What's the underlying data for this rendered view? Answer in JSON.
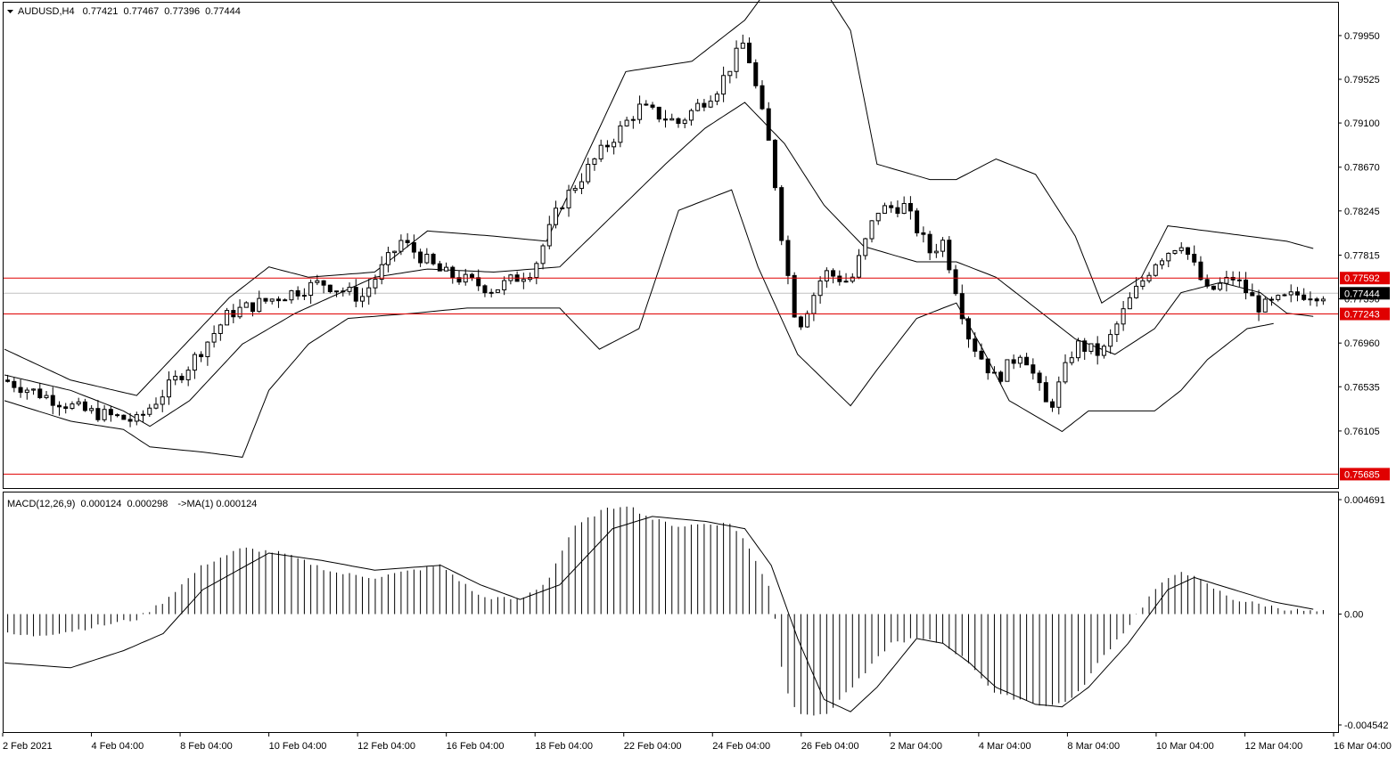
{
  "header": {
    "symbol": "AUDUSD,H4",
    "open": "0.77421",
    "high": "0.77467",
    "low": "0.77396",
    "close": "0.77444"
  },
  "macd_header": {
    "name": "MACD(12,26,9)",
    "main": "0.000124",
    "signal": "0.000298",
    "ma_label": "->MA(1)",
    "ma_value": "0.000124"
  },
  "colors": {
    "background": "#ffffff",
    "foreground": "#000000",
    "level_line": "#e00000",
    "level_label_bg": "#e00000",
    "current_price_bg": "#000000",
    "current_price_line": "#c0c0c0",
    "macd_signal_shadow": "#a0a0c8"
  },
  "price_axis": {
    "ticks": [
      "0.79950",
      "0.79525",
      "0.79100",
      "0.78670",
      "0.78245",
      "0.77815",
      "0.77390",
      "0.76960",
      "0.76535",
      "0.76105"
    ]
  },
  "macd_axis": {
    "ticks": [
      "0.004691",
      "0.00",
      "-0.004542"
    ]
  },
  "time_axis": {
    "labels": [
      "2 Feb 2021",
      "4 Feb 04:00",
      "8 Feb 04:00",
      "10 Feb 04:00",
      "12 Feb 04:00",
      "16 Feb 04:00",
      "18 Feb 04:00",
      "22 Feb 04:00",
      "24 Feb 04:00",
      "26 Feb 04:00",
      "2 Mar 04:00",
      "4 Mar 04:00",
      "8 Mar 04:00",
      "10 Mar 04:00",
      "12 Mar 04:00",
      "16 Mar 04:00"
    ]
  },
  "levels": [
    {
      "value": 0.77592,
      "label": "0.77592"
    },
    {
      "value": 0.77243,
      "label": "0.77243"
    },
    {
      "value": 0.75685,
      "label": "0.75685"
    }
  ],
  "current_price": {
    "value": 0.77444,
    "label": "0.77444"
  },
  "chart_data": {
    "type": "candlestick",
    "symbol": "AUDUSD",
    "timeframe": "H4",
    "ylim_price": [
      0.7555,
      0.8027
    ],
    "ylim_macd": [
      -0.004542,
      0.004691
    ],
    "bollinger_anchors": {
      "upper": [
        [
          0,
          0.769
        ],
        [
          0.05,
          0.766
        ],
        [
          0.1,
          0.7645
        ],
        [
          0.17,
          0.774
        ],
        [
          0.2,
          0.777
        ],
        [
          0.23,
          0.776
        ],
        [
          0.28,
          0.7765
        ],
        [
          0.32,
          0.7805
        ],
        [
          0.37,
          0.78
        ],
        [
          0.41,
          0.7795
        ],
        [
          0.43,
          0.785
        ],
        [
          0.47,
          0.796
        ],
        [
          0.52,
          0.797
        ],
        [
          0.56,
          0.801
        ],
        [
          0.6,
          0.808
        ],
        [
          0.64,
          0.8
        ],
        [
          0.66,
          0.787
        ],
        [
          0.7,
          0.7855
        ],
        [
          0.72,
          0.7855
        ],
        [
          0.75,
          0.7875
        ],
        [
          0.78,
          0.786
        ],
        [
          0.81,
          0.78
        ],
        [
          0.83,
          0.7735
        ],
        [
          0.86,
          0.776
        ],
        [
          0.88,
          0.781
        ],
        [
          0.91,
          0.7805
        ],
        [
          0.94,
          0.78
        ],
        [
          0.97,
          0.7795
        ],
        [
          0.99,
          0.7788
        ]
      ],
      "middle": [
        [
          0,
          0.7665
        ],
        [
          0.05,
          0.765
        ],
        [
          0.09,
          0.763
        ],
        [
          0.11,
          0.7615
        ],
        [
          0.14,
          0.764
        ],
        [
          0.18,
          0.7695
        ],
        [
          0.22,
          0.7725
        ],
        [
          0.28,
          0.776
        ],
        [
          0.32,
          0.7768
        ],
        [
          0.37,
          0.7765
        ],
        [
          0.42,
          0.777
        ],
        [
          0.46,
          0.782
        ],
        [
          0.5,
          0.787
        ],
        [
          0.53,
          0.7905
        ],
        [
          0.56,
          0.793
        ],
        [
          0.59,
          0.789
        ],
        [
          0.62,
          0.783
        ],
        [
          0.65,
          0.779
        ],
        [
          0.69,
          0.7775
        ],
        [
          0.72,
          0.7775
        ],
        [
          0.75,
          0.776
        ],
        [
          0.78,
          0.773
        ],
        [
          0.81,
          0.77
        ],
        [
          0.84,
          0.7685
        ],
        [
          0.87,
          0.771
        ],
        [
          0.89,
          0.7745
        ],
        [
          0.92,
          0.7755
        ],
        [
          0.95,
          0.7745
        ],
        [
          0.97,
          0.7725
        ],
        [
          0.99,
          0.7722
        ]
      ],
      "lower": [
        [
          0,
          0.764
        ],
        [
          0.05,
          0.762
        ],
        [
          0.09,
          0.7612
        ],
        [
          0.11,
          0.7595
        ],
        [
          0.15,
          0.759
        ],
        [
          0.18,
          0.7585
        ],
        [
          0.2,
          0.765
        ],
        [
          0.23,
          0.7695
        ],
        [
          0.26,
          0.772
        ],
        [
          0.31,
          0.7725
        ],
        [
          0.35,
          0.773
        ],
        [
          0.42,
          0.773
        ],
        [
          0.45,
          0.769
        ],
        [
          0.48,
          0.771
        ],
        [
          0.51,
          0.7825
        ],
        [
          0.55,
          0.7845
        ],
        [
          0.57,
          0.777
        ],
        [
          0.6,
          0.7685
        ],
        [
          0.64,
          0.7635
        ],
        [
          0.66,
          0.767
        ],
        [
          0.69,
          0.772
        ],
        [
          0.72,
          0.7735
        ],
        [
          0.74,
          0.769
        ],
        [
          0.76,
          0.764
        ],
        [
          0.78,
          0.7625
        ],
        [
          0.8,
          0.761
        ],
        [
          0.82,
          0.763
        ],
        [
          0.85,
          0.763
        ],
        [
          0.87,
          0.763
        ],
        [
          0.89,
          0.765
        ],
        [
          0.91,
          0.768
        ],
        [
          0.94,
          0.771
        ],
        [
          0.96,
          0.7715
        ]
      ]
    },
    "candle_anchors": [
      [
        0,
        0.766
      ],
      [
        0.06,
        0.763
      ],
      [
        0.1,
        0.762
      ],
      [
        0.14,
        0.7675
      ],
      [
        0.17,
        0.7725
      ],
      [
        0.24,
        0.7755
      ],
      [
        0.27,
        0.774
      ],
      [
        0.3,
        0.7795
      ],
      [
        0.33,
        0.7765
      ],
      [
        0.37,
        0.7748
      ],
      [
        0.4,
        0.7768
      ],
      [
        0.42,
        0.783
      ],
      [
        0.45,
        0.788
      ],
      [
        0.48,
        0.7925
      ],
      [
        0.51,
        0.791
      ],
      [
        0.54,
        0.7945
      ],
      [
        0.56,
        0.799
      ],
      [
        0.58,
        0.788
      ],
      [
        0.59,
        0.778
      ],
      [
        0.6,
        0.771
      ],
      [
        0.62,
        0.7765
      ],
      [
        0.64,
        0.7755
      ],
      [
        0.66,
        0.7825
      ],
      [
        0.68,
        0.783
      ],
      [
        0.7,
        0.7785
      ],
      [
        0.71,
        0.7795
      ],
      [
        0.73,
        0.77
      ],
      [
        0.75,
        0.766
      ],
      [
        0.77,
        0.769
      ],
      [
        0.79,
        0.763
      ],
      [
        0.81,
        0.7695
      ],
      [
        0.83,
        0.7685
      ],
      [
        0.85,
        0.7735
      ],
      [
        0.87,
        0.7775
      ],
      [
        0.89,
        0.7795
      ],
      [
        0.91,
        0.7745
      ],
      [
        0.93,
        0.776
      ],
      [
        0.95,
        0.773
      ],
      [
        0.96,
        0.7735
      ],
      [
        0.98,
        0.7744
      ],
      [
        1.0,
        0.7744
      ]
    ],
    "candle_count": 205,
    "macd_histogram_anchors": [
      [
        0,
        -0.0008
      ],
      [
        0.02,
        -0.0009
      ],
      [
        0.05,
        -0.0007
      ],
      [
        0.08,
        -0.0004
      ],
      [
        0.1,
        -0.0002
      ],
      [
        0.12,
        0.0005
      ],
      [
        0.15,
        0.002
      ],
      [
        0.18,
        0.0027
      ],
      [
        0.21,
        0.0025
      ],
      [
        0.25,
        0.0017
      ],
      [
        0.28,
        0.0015
      ],
      [
        0.31,
        0.0018
      ],
      [
        0.33,
        0.002
      ],
      [
        0.36,
        0.0007
      ],
      [
        0.39,
        0.0006
      ],
      [
        0.41,
        0.0013
      ],
      [
        0.43,
        0.0035
      ],
      [
        0.45,
        0.0042
      ],
      [
        0.47,
        0.0045
      ],
      [
        0.49,
        0.0039
      ],
      [
        0.51,
        0.0036
      ],
      [
        0.53,
        0.0037
      ],
      [
        0.55,
        0.0037
      ],
      [
        0.56,
        0.003
      ],
      [
        0.58,
        0.001
      ],
      [
        0.59,
        -0.003
      ],
      [
        0.6,
        -0.004
      ],
      [
        0.62,
        -0.0042
      ],
      [
        0.63,
        -0.0036
      ],
      [
        0.65,
        -0.0025
      ],
      [
        0.67,
        -0.0012
      ],
      [
        0.69,
        -0.001
      ],
      [
        0.71,
        -0.0012
      ],
      [
        0.73,
        -0.002
      ],
      [
        0.75,
        -0.0033
      ],
      [
        0.77,
        -0.0035
      ],
      [
        0.79,
        -0.0038
      ],
      [
        0.81,
        -0.0034
      ],
      [
        0.83,
        -0.0018
      ],
      [
        0.85,
        -0.0005
      ],
      [
        0.87,
        0.001
      ],
      [
        0.89,
        0.0018
      ],
      [
        0.91,
        0.0012
      ],
      [
        0.93,
        0.0006
      ],
      [
        0.95,
        0.0004
      ],
      [
        0.97,
        0.0002
      ],
      [
        0.99,
        0.0001
      ]
    ],
    "macd_signal_anchors": [
      [
        0,
        -0.002
      ],
      [
        0.05,
        -0.0022
      ],
      [
        0.09,
        -0.0015
      ],
      [
        0.12,
        -0.0008
      ],
      [
        0.15,
        0.001
      ],
      [
        0.2,
        0.0025
      ],
      [
        0.24,
        0.0022
      ],
      [
        0.28,
        0.0018
      ],
      [
        0.33,
        0.002
      ],
      [
        0.36,
        0.0012
      ],
      [
        0.39,
        0.0006
      ],
      [
        0.42,
        0.0012
      ],
      [
        0.46,
        0.0035
      ],
      [
        0.49,
        0.004
      ],
      [
        0.53,
        0.0038
      ],
      [
        0.56,
        0.0035
      ],
      [
        0.58,
        0.002
      ],
      [
        0.6,
        -0.001
      ],
      [
        0.62,
        -0.0035
      ],
      [
        0.64,
        -0.004
      ],
      [
        0.66,
        -0.003
      ],
      [
        0.69,
        -0.001
      ],
      [
        0.71,
        -0.0012
      ],
      [
        0.73,
        -0.002
      ],
      [
        0.75,
        -0.003
      ],
      [
        0.78,
        -0.0037
      ],
      [
        0.8,
        -0.0038
      ],
      [
        0.82,
        -0.003
      ],
      [
        0.85,
        -0.0012
      ],
      [
        0.88,
        0.001
      ],
      [
        0.9,
        0.0015
      ],
      [
        0.93,
        0.001
      ],
      [
        0.96,
        0.0005
      ],
      [
        0.99,
        0.0002
      ]
    ]
  }
}
